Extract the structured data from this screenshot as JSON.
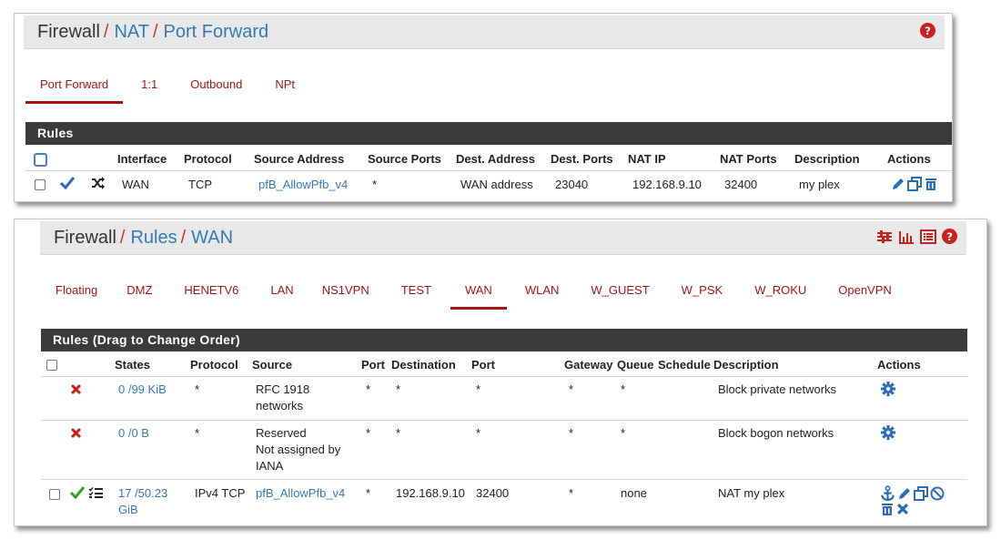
{
  "panel1": {
    "breadcrumb": {
      "root": "Firewall",
      "sep1": "/",
      "mid": "NAT",
      "sep2": "/",
      "current": "Port Forward"
    },
    "tabs": [
      "Port Forward",
      "1:1",
      "Outbound",
      "NPt"
    ],
    "active_tab": "Port Forward",
    "section_title": "Rules",
    "columns": [
      "Interface",
      "Protocol",
      "Source Address",
      "Source Ports",
      "Dest. Address",
      "Dest. Ports",
      "NAT IP",
      "NAT Ports",
      "Description",
      "Actions"
    ],
    "row": {
      "interface": "WAN",
      "protocol": "TCP",
      "source_address": "pfB_AllowPfb_v4",
      "source_ports": "*",
      "dest_address": "WAN address",
      "dest_ports": "23040",
      "nat_ip": "192.168.9.10",
      "nat_ports": "32400",
      "description": "my plex"
    }
  },
  "panel2": {
    "breadcrumb": {
      "root": "Firewall",
      "sep1": "/",
      "mid": "Rules",
      "sep2": "/",
      "current": "WAN"
    },
    "tabs": [
      "Floating",
      "DMZ",
      "HENETV6",
      "LAN",
      "NS1VPN",
      "TEST",
      "WAN",
      "WLAN",
      "W_GUEST",
      "W_PSK",
      "W_ROKU",
      "OpenVPN"
    ],
    "active_tab": "WAN",
    "section_title": "Rules (Drag to Change Order)",
    "columns": [
      "States",
      "Protocol",
      "Source",
      "Port",
      "Destination",
      "Port",
      "Gateway",
      "Queue",
      "Schedule",
      "Description",
      "Actions"
    ],
    "rows": [
      {
        "states": "0 /99 KiB",
        "protocol": "*",
        "source_l1": "RFC 1918",
        "source_l2": "networks",
        "source_l3": "",
        "port": "*",
        "destination": "*",
        "dport": "*",
        "gateway": "*",
        "queue": "*",
        "schedule": "",
        "description": "Block private networks"
      },
      {
        "states": "0 /0 B",
        "protocol": "*",
        "source_l1": "Reserved",
        "source_l2": "Not assigned by",
        "source_l3": "IANA",
        "port": "*",
        "destination": "*",
        "dport": "*",
        "gateway": "*",
        "queue": "*",
        "schedule": "",
        "description": "Block bogon networks"
      },
      {
        "states_l1": "17 /50.23",
        "states_l2": "GiB",
        "protocol": "IPv4 TCP",
        "source": "pfB_AllowPfb_v4",
        "port": "*",
        "destination": "192.168.9.10",
        "dport": "32400",
        "gateway": "*",
        "queue": "none",
        "schedule": "",
        "description": "NAT my plex"
      }
    ]
  },
  "colors": {
    "accent": "#a31515",
    "link": "#3479b7",
    "header_bg": "#3b3b3b",
    "crumb_bg": "#e8e8e8",
    "pass": "#2aa52a",
    "block": "#c9211e",
    "icon_blue": "#2a6cb8"
  }
}
